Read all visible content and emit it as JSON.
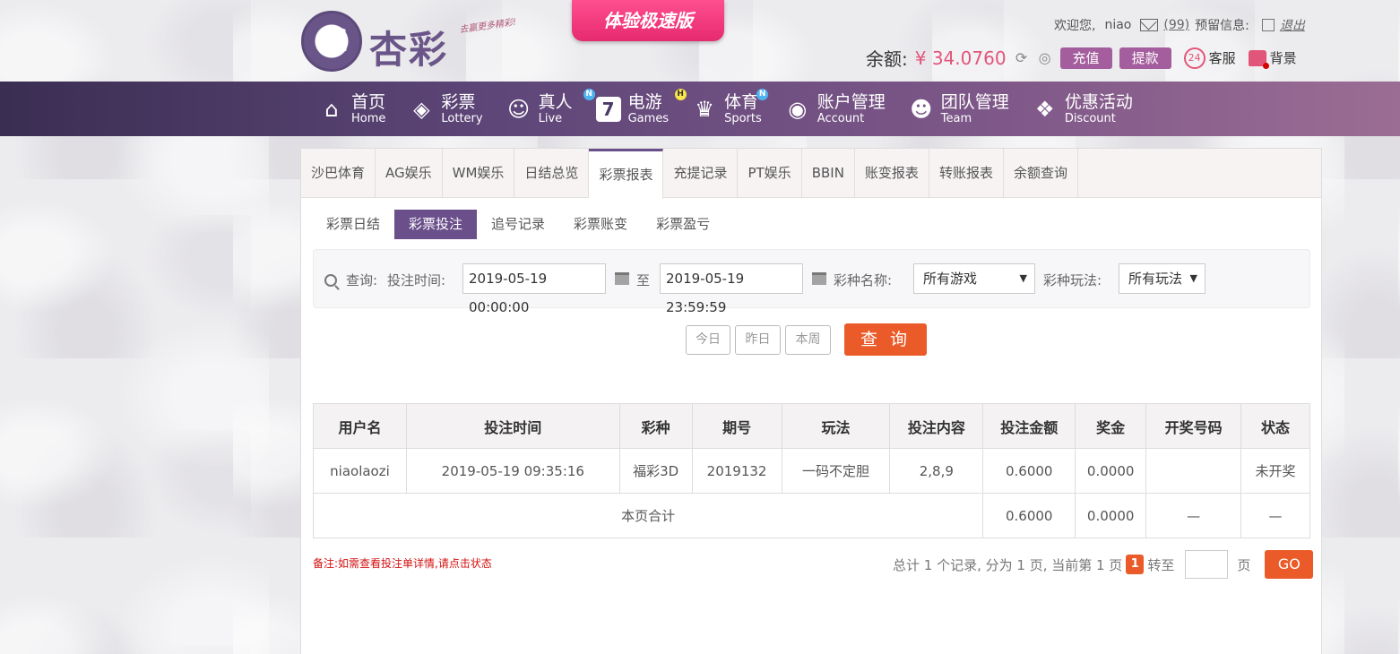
{
  "header": {
    "logo_text": "杏彩",
    "slogan": "去赢更多精彩!",
    "speed_badge": "体验极速版",
    "welcome_prefix": "欢迎您,",
    "username": "niao",
    "message_count": "(99)",
    "reserve_label": "预留信息:",
    "logout": "退出",
    "balance_label": "余额:",
    "balance_value": "¥ 34.0760",
    "recharge": "充值",
    "withdraw": "提款",
    "service": "客服",
    "service_icon_text": "24",
    "background": "背景"
  },
  "nav": {
    "items": [
      {
        "cn": "首页",
        "en": "Home",
        "icon": "home-icon"
      },
      {
        "cn": "彩票",
        "en": "Lottery",
        "icon": "ticket-icon"
      },
      {
        "cn": "真人",
        "en": "Live",
        "icon": "dealer-icon",
        "badge": "N"
      },
      {
        "cn": "电游",
        "en": "Games",
        "icon": "slot-icon",
        "badge": "H"
      },
      {
        "cn": "体育",
        "en": "Sports",
        "icon": "trophy-icon",
        "badge": "N"
      },
      {
        "cn": "账户管理",
        "en": "Account",
        "icon": "account-icon"
      },
      {
        "cn": "团队管理",
        "en": "Team",
        "icon": "team-icon"
      },
      {
        "cn": "优惠活动",
        "en": "Discount",
        "icon": "gift-icon"
      }
    ]
  },
  "top_tabs": [
    "沙巴体育",
    "AG娱乐",
    "WM娱乐",
    "日结总览",
    "彩票报表",
    "充提记录",
    "PT娱乐",
    "BBIN",
    "账变报表",
    "转账报表",
    "余额查询"
  ],
  "active_top_tab": "彩票报表",
  "sub_tabs": [
    "彩票日结",
    "彩票投注",
    "追号记录",
    "彩票账变",
    "彩票盈亏"
  ],
  "filter": {
    "search_label": "查询:",
    "time_label": "投注时间:",
    "start_time": "2019-05-19 00:00:00",
    "to_label": "至",
    "end_time": "2019-05-19 23:59:59",
    "game_label": "彩种名称:",
    "game_value": "所有游戏",
    "play_label": "彩种玩法:",
    "play_value": "所有玩法",
    "today": "今日",
    "yesterday": "昨日",
    "this_week": "本周",
    "query": "查 询"
  },
  "table": {
    "headers": [
      "用户名",
      "投注时间",
      "彩种",
      "期号",
      "玩法",
      "投注内容",
      "投注金额",
      "奖金",
      "开奖号码",
      "状态"
    ],
    "rows": [
      [
        "niaolaozi",
        "2019-05-19 09:35:16",
        "福彩3D",
        "2019132",
        "一码不定胆",
        "2,8,9",
        "0.6000",
        "0.0000",
        "",
        "未开奖"
      ]
    ],
    "summary": {
      "label": "本页合计",
      "amount": "0.6000",
      "bonus": "0.0000",
      "draw": "—",
      "status": "—"
    }
  },
  "note": "备注:如需查看投注单详情,请点击状态",
  "pager": {
    "text": "总计 1 个记录, 分为 1 页, 当前第 1 页",
    "current": "1",
    "goto_label": "转至",
    "page_unit": "页",
    "go": "GO"
  }
}
